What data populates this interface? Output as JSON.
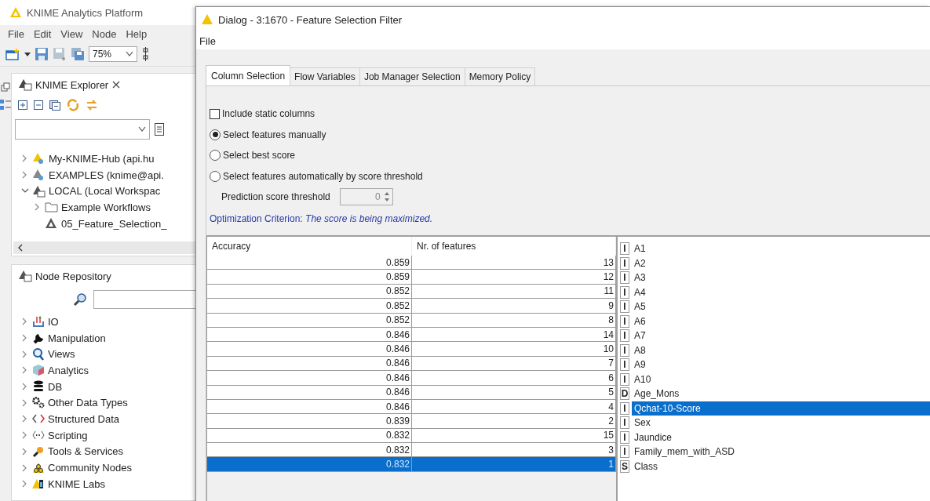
{
  "app": {
    "title": "KNIME Analytics Platform",
    "menu": [
      "File",
      "Edit",
      "View",
      "Node",
      "Help"
    ],
    "zoom": "75%",
    "explorer": {
      "title": "KNIME Explorer",
      "tree": [
        {
          "label": "My-KNIME-Hub (api.hu",
          "kind": "hub",
          "expanded": false
        },
        {
          "label": "EXAMPLES (knime@api.",
          "kind": "hub-grey",
          "expanded": false
        },
        {
          "label": "LOCAL (Local Workspac",
          "kind": "local",
          "expanded": true,
          "children": [
            {
              "label": "Example Workflows",
              "kind": "folder",
              "expanded": false
            },
            {
              "label": "05_Feature_Selection_",
              "kind": "workflow"
            }
          ]
        }
      ]
    },
    "repository": {
      "title": "Node Repository",
      "categories": [
        {
          "label": "IO",
          "expanded": false
        },
        {
          "label": "Manipulation",
          "expanded": false
        },
        {
          "label": "Views",
          "expanded": false
        },
        {
          "label": "Analytics",
          "expanded": false
        },
        {
          "label": "DB",
          "expanded": false
        },
        {
          "label": "Other Data Types",
          "expanded": false
        },
        {
          "label": "Structured Data",
          "expanded": false
        },
        {
          "label": "Scripting",
          "expanded": false
        },
        {
          "label": "Tools & Services",
          "expanded": false
        },
        {
          "label": "Community Nodes",
          "expanded": false
        },
        {
          "label": "KNIME Labs",
          "expanded": false
        }
      ]
    }
  },
  "dialog": {
    "title": "Dialog - 3:1670 - Feature Selection Filter",
    "menu": [
      "File"
    ],
    "tabs": [
      {
        "label": "Column Selection",
        "selected": true
      },
      {
        "label": "Flow Variables",
        "selected": false
      },
      {
        "label": "Job Manager Selection",
        "selected": false
      },
      {
        "label": "Memory Policy",
        "selected": false
      }
    ],
    "include_static": {
      "label": "Include static columns",
      "checked": false
    },
    "modes": [
      {
        "label": "Select features manually",
        "selected": true
      },
      {
        "label": "Select best score",
        "selected": false
      },
      {
        "label": "Select features automatically by score threshold",
        "selected": false
      }
    ],
    "threshold": {
      "label": "Prediction score threshold",
      "value": "0",
      "disabled": true
    },
    "criterion": "Optimization Criterion: *The score is being maximized.*",
    "table": {
      "columns": [
        "Accuracy",
        "Nr. of features"
      ],
      "rows": [
        {
          "cells": [
            "0.859",
            "13"
          ],
          "selected": false
        },
        {
          "cells": [
            "0.859",
            "12"
          ],
          "selected": false
        },
        {
          "cells": [
            "0.852",
            "11"
          ],
          "selected": false
        },
        {
          "cells": [
            "0.852",
            "9"
          ],
          "selected": false
        },
        {
          "cells": [
            "0.852",
            "8"
          ],
          "selected": false
        },
        {
          "cells": [
            "0.846",
            "14"
          ],
          "selected": false
        },
        {
          "cells": [
            "0.846",
            "10"
          ],
          "selected": false
        },
        {
          "cells": [
            "0.846",
            "7"
          ],
          "selected": false
        },
        {
          "cells": [
            "0.846",
            "6"
          ],
          "selected": false
        },
        {
          "cells": [
            "0.846",
            "5"
          ],
          "selected": false
        },
        {
          "cells": [
            "0.846",
            "4"
          ],
          "selected": false
        },
        {
          "cells": [
            "0.839",
            "2"
          ],
          "selected": false
        },
        {
          "cells": [
            "0.832",
            "15"
          ],
          "selected": false
        },
        {
          "cells": [
            "0.832",
            "3"
          ],
          "selected": false
        },
        {
          "cells": [
            "0.832",
            "1"
          ],
          "selected": true
        }
      ]
    },
    "columns": [
      {
        "type": "I",
        "name": "A1",
        "selected": false
      },
      {
        "type": "I",
        "name": "A2",
        "selected": false
      },
      {
        "type": "I",
        "name": "A3",
        "selected": false
      },
      {
        "type": "I",
        "name": "A4",
        "selected": false
      },
      {
        "type": "I",
        "name": "A5",
        "selected": false
      },
      {
        "type": "I",
        "name": "A6",
        "selected": false
      },
      {
        "type": "I",
        "name": "A7",
        "selected": false
      },
      {
        "type": "I",
        "name": "A8",
        "selected": false
      },
      {
        "type": "I",
        "name": "A9",
        "selected": false
      },
      {
        "type": "I",
        "name": "A10",
        "selected": false
      },
      {
        "type": "D",
        "name": "Age_Mons",
        "selected": false
      },
      {
        "type": "I",
        "name": "Qchat-10-Score",
        "selected": true
      },
      {
        "type": "I",
        "name": "Sex",
        "selected": false
      },
      {
        "type": "I",
        "name": "Jaundice",
        "selected": false
      },
      {
        "type": "I",
        "name": "Family_mem_with_ASD",
        "selected": false
      },
      {
        "type": "S",
        "name": "Class",
        "selected": false
      }
    ]
  }
}
